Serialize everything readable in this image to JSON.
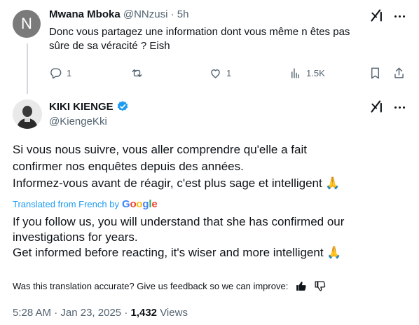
{
  "reply": {
    "avatar_letter": "N",
    "author_name": "Mwana Mboka",
    "author_handle": "@NNzusi",
    "separator": "·",
    "time": "5h",
    "text_line1": "Donc vous partagez une information dont vous même n êtes pas",
    "text_line2": "sûre de sa véracité ? Eish",
    "actions": {
      "reply_count": "1",
      "repost_count": "",
      "like_count": "1",
      "views_count": "1.5K"
    }
  },
  "main": {
    "author_name": "KIKI KIENGE",
    "author_handle": "@KiengeKki",
    "verified": true,
    "original_lines": [
      "Si vous nous suivre, vous aller comprendre qu'elle a fait",
      "confirmer nos enquêtes depuis des années.",
      "Informez-vous avant de réagir, c'est plus sage et intelligent 🙏"
    ],
    "translated_label": "Translated from French by",
    "translator": "Google",
    "translated_lines": [
      "If you follow us, you will understand that she has confirmed our",
      "investigations for years.",
      "Get informed before reacting, it's wiser and more intelligent 🙏"
    ],
    "feedback_prompt": "Was this translation accurate? Give us feedback so we can improve:",
    "time": "5:28 AM",
    "date": "Jan 23, 2025",
    "views_count": "1,432",
    "views_label": "Views"
  },
  "colors": {
    "accent": "#1d9bf0",
    "muted": "#536471",
    "text": "#0f1419",
    "google_blue": "#4285F4",
    "google_red": "#EA4335",
    "google_yellow": "#FBBC05",
    "google_green": "#34A853"
  },
  "icons": [
    "grok-icon",
    "more-icon",
    "reply-icon",
    "repost-icon",
    "like-icon",
    "views-icon",
    "bookmark-icon",
    "share-icon",
    "verified-badge-icon",
    "thumbs-up-icon",
    "thumbs-down-icon"
  ]
}
